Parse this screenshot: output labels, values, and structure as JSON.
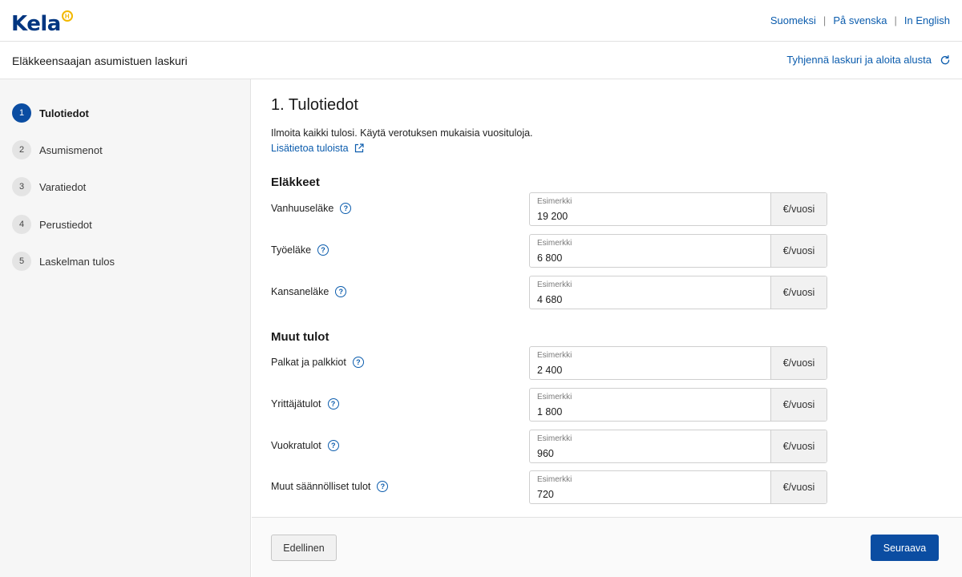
{
  "brand": {
    "logo_text": "Kela",
    "logo_badge": "H"
  },
  "languages": [
    {
      "label": "Suomeksi"
    },
    {
      "label": "På svenska"
    },
    {
      "label": "In English"
    }
  ],
  "language_separator": "|",
  "app": {
    "title": "Eläkkeensaajan asumistuen laskuri",
    "reset_label": "Tyhjennä laskuri ja aloita alusta"
  },
  "steps": [
    {
      "number": "1",
      "label": "Tulotiedot",
      "active": true
    },
    {
      "number": "2",
      "label": "Asumismenot",
      "active": false
    },
    {
      "number": "3",
      "label": "Varatiedot",
      "active": false
    },
    {
      "number": "4",
      "label": "Perustiedot",
      "active": false
    },
    {
      "number": "5",
      "label": "Laskelman tulos",
      "active": false
    }
  ],
  "main": {
    "title": "1. Tulotiedot",
    "intro": "Ilmoita kaikki tulosi. Käytä verotuksen mukaisia vuosituloja.",
    "more_link": "Lisätietoa tuloista",
    "groups": [
      {
        "title": "Eläkkeet",
        "fields": [
          {
            "label": "Vanhuuseläke",
            "placeholder": "Esimerkki",
            "value": "19 200",
            "unit": "€/vuosi"
          },
          {
            "label": "Työeläke",
            "placeholder": "Esimerkki",
            "value": "6 800",
            "unit": "€/vuosi"
          },
          {
            "label": "Kansaneläke",
            "placeholder": "Esimerkki",
            "value": "4 680",
            "unit": "€/vuosi"
          }
        ]
      },
      {
        "title": "Muut tulot",
        "fields": [
          {
            "label": "Palkat ja palkkiot",
            "placeholder": "Esimerkki",
            "value": "2 400",
            "unit": "€/vuosi"
          },
          {
            "label": "Yrittäjätulot",
            "placeholder": "Esimerkki",
            "value": "1 800",
            "unit": "€/vuosi"
          },
          {
            "label": "Vuokratulot",
            "placeholder": "Esimerkki",
            "value": "960",
            "unit": "€/vuosi"
          },
          {
            "label": "Muut säännölliset tulot",
            "placeholder": "Esimerkki",
            "value": "720",
            "unit": "€/vuosi"
          }
        ]
      }
    ],
    "help_glyph": "?"
  },
  "footer": {
    "prev_label": "Edellinen",
    "next_label": "Seuraava"
  },
  "colors": {
    "brand_blue": "#003580",
    "accent": "#0b4da2",
    "link": "#0b5cad",
    "badge_yellow": "#f2b800"
  }
}
